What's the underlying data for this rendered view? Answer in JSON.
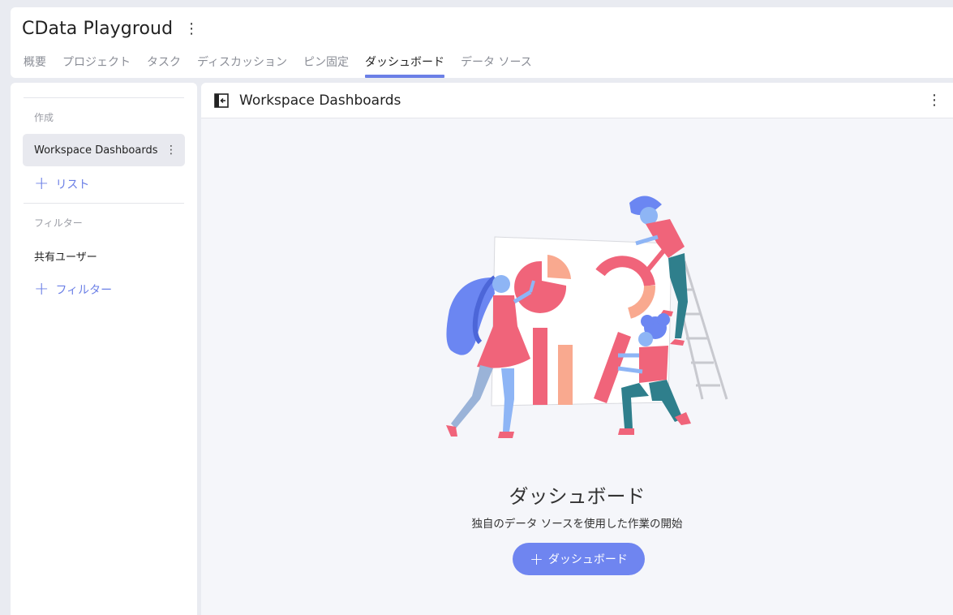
{
  "header": {
    "project_title": "CData Playgroud",
    "tabs": [
      {
        "label": "概要"
      },
      {
        "label": "プロジェクト"
      },
      {
        "label": "タスク"
      },
      {
        "label": "ディスカッション"
      },
      {
        "label": "ピン固定"
      },
      {
        "label": "ダッシュボード"
      },
      {
        "label": "データ ソース"
      }
    ],
    "active_tab": "ダッシュボード"
  },
  "sidebar": {
    "create_label": "作成",
    "selected_item": "Workspace Dashboards",
    "add_list_label": "リスト",
    "filter_label": "フィルター",
    "shared_users": "共有ユーザー",
    "add_filter_label": "フィルター"
  },
  "main": {
    "title": "Workspace Dashboards",
    "empty_title": "ダッシュボード",
    "empty_subtitle": "独自のデータ ソースを使用した作業の開始",
    "cta_label": "ダッシュボード"
  },
  "icons": {
    "kebab": "kebab-icon",
    "collapse": "collapse-sidebar-icon",
    "plus": "plus-icon"
  },
  "colors": {
    "accent": "#6b7fe6",
    "button": "#6f85f0",
    "illustration_red": "#f0647a",
    "illustration_peach": "#f9a98f",
    "illustration_blue": "#6b86f2"
  }
}
